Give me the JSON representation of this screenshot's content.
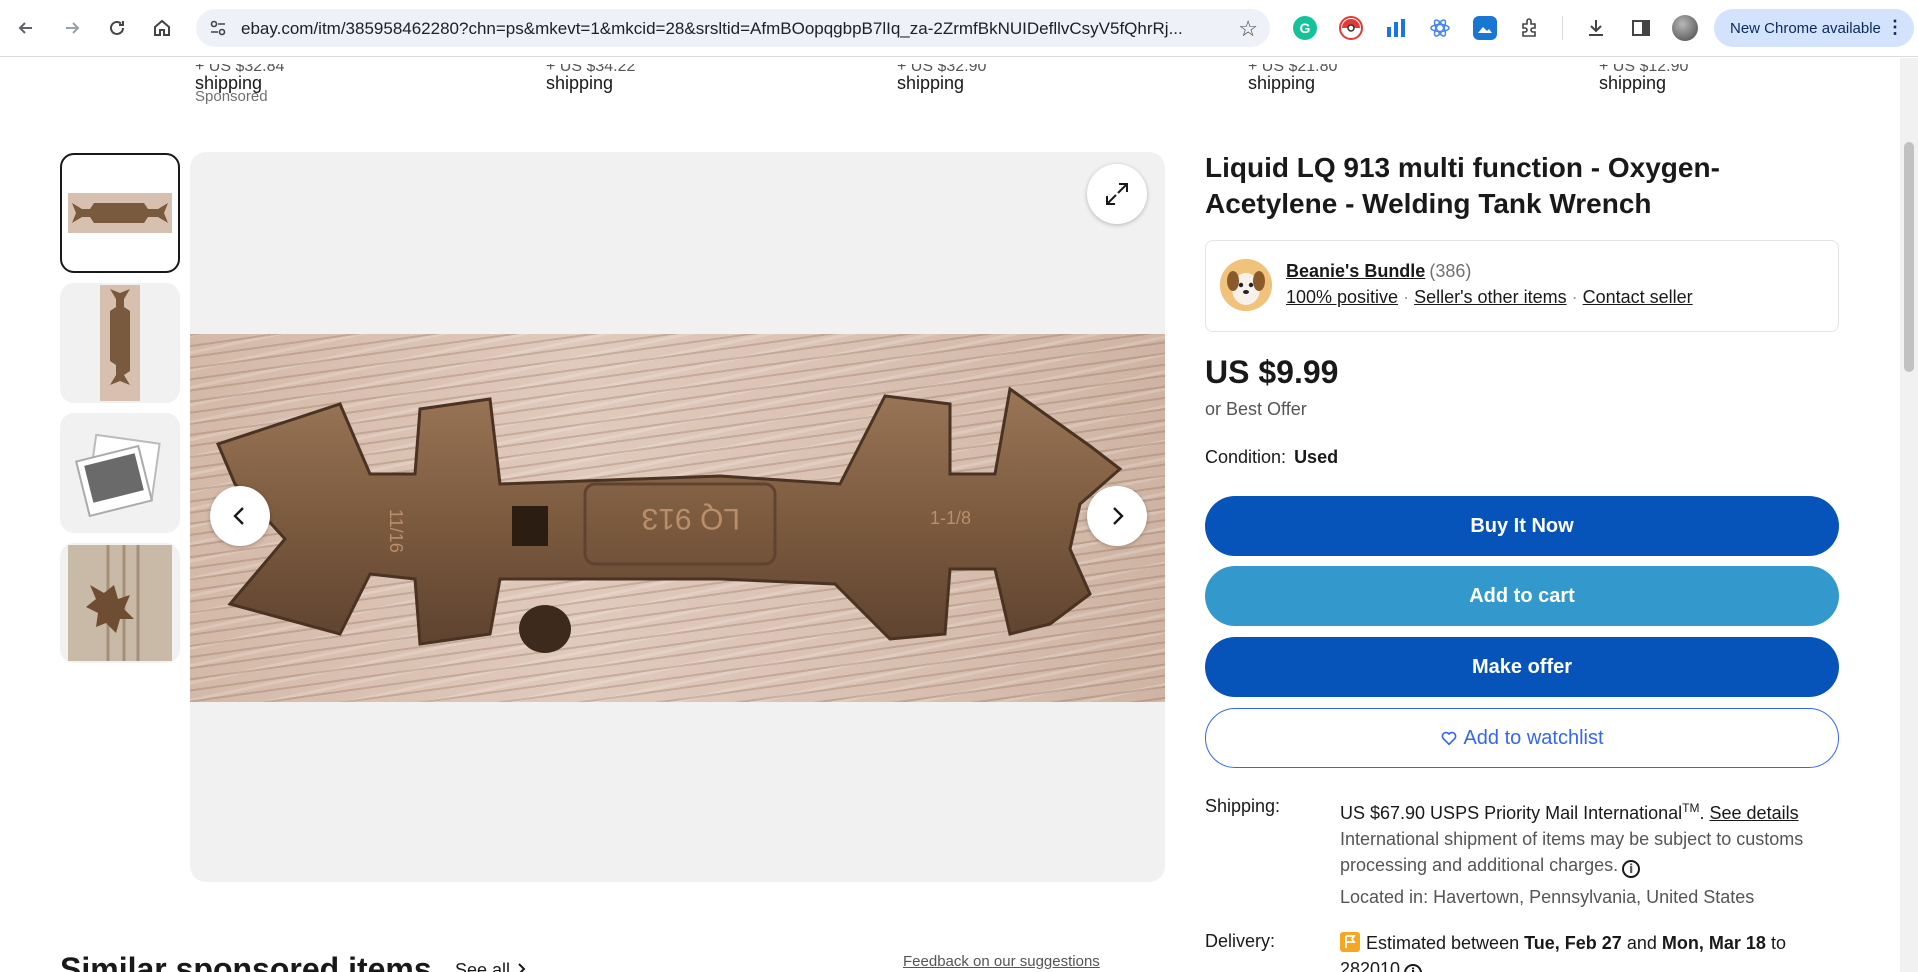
{
  "browser": {
    "url": "ebay.com/itm/385958462280?chn=ps&mkevt=1&mkcid=28&srsltid=AfmBOopqgbpB7lIq_za-2ZrmfBkNUIDefllvCsyV5fQhrRj...",
    "new_chrome_label": "New Chrome available"
  },
  "top_strip": {
    "shipping_label": "shipping",
    "cut_prices": [
      "+ US $32.84",
      "+ US $34.22",
      "+ US $32.90",
      "+ US $21.80",
      "+ US $12.90"
    ],
    "sponsored_label": "Sponsored"
  },
  "listing": {
    "title": "Liquid LQ 913 multi function - Oxygen-Acetylene - Welding Tank Wrench",
    "seller": {
      "name": "Beanie's Bundle",
      "feedback_count": "(386)",
      "positive": "100% positive",
      "other_items": "Seller's other items",
      "contact": "Contact seller"
    },
    "price": "US $9.99",
    "best_offer": "or Best Offer",
    "condition_label": "Condition:",
    "condition_value": "Used",
    "buttons": {
      "buy_now": "Buy It Now",
      "add_to_cart": "Add to cart",
      "make_offer": "Make offer",
      "watchlist": "Add to watchlist"
    },
    "shipping": {
      "label": "Shipping:",
      "price": "US $67.90 USPS Priority Mail International",
      "tm": "TM",
      "see_details": "See details",
      "international_note": "International shipment of items may be subject to customs processing and additional charges.",
      "located_in": "Located in: Havertown, Pennsylvania, United States"
    },
    "delivery": {
      "label": "Delivery:",
      "prefix": "Estimated between",
      "date_start": "Tue, Feb 27",
      "and": "and",
      "date_end": "Mon, Mar 18",
      "to": "to",
      "zip": "282010"
    },
    "image": {
      "engraving_main": "LQ 913",
      "engraving_left": "11/16",
      "engraving_right": "1-1/8"
    }
  },
  "similar": {
    "title": "Similar sponsored items",
    "see_all": "See all",
    "feedback": "Feedback on our suggestions"
  }
}
